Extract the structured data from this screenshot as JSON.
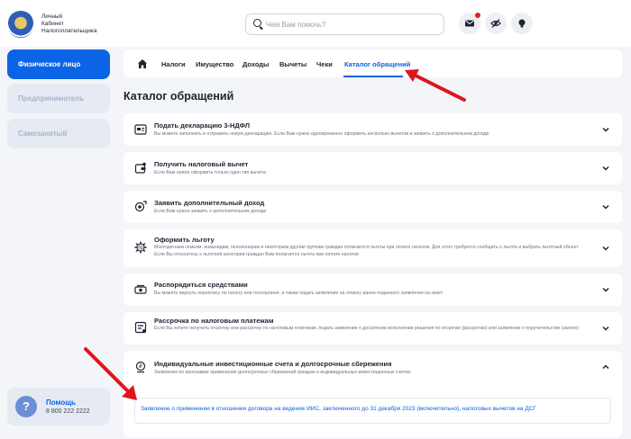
{
  "header": {
    "logo_lines": [
      "Личный",
      "Кабинет",
      "Налогоплательщика"
    ],
    "search_placeholder": "Чем Вам помочь?",
    "icons": [
      "mail-icon",
      "eye-off-icon",
      "lightbulb-icon"
    ]
  },
  "sidebar": {
    "items": [
      {
        "label": "Физическое лицо",
        "active": true
      },
      {
        "label": "Предприниматель",
        "active": false
      },
      {
        "label": "Самозанятый",
        "active": false
      }
    ],
    "help": {
      "title": "Помощь",
      "phone": "8 800 222 2222"
    }
  },
  "tabs": [
    {
      "label": "Налоги",
      "active": false
    },
    {
      "label": "Имущество",
      "active": false
    },
    {
      "label": "Доходы",
      "active": false
    },
    {
      "label": "Вычеты",
      "active": false
    },
    {
      "label": "Чеки",
      "active": false
    },
    {
      "label": "Каталог обращений",
      "active": true
    }
  ],
  "page_title": "Каталог обращений",
  "cards": [
    {
      "title": "Подать декларацию 3-НДФЛ",
      "desc": "Вы можете заполнить и отправить новую декларацию. Если Вам нужно одновременно оформить несколько вычетов и заявить о дополнительном доходе",
      "icon": "declaration-icon",
      "expanded": false
    },
    {
      "title": "Получить налоговый вычет",
      "desc": "Если Вам нужно оформить только один тип вычета",
      "icon": "wallet-icon",
      "expanded": false
    },
    {
      "title": "Заявить дополнительный доход",
      "desc": "Если Вам нужно заявить о дополнительном доходе",
      "icon": "income-icon",
      "expanded": false
    },
    {
      "title": "Оформить льготу",
      "desc": "Многодетным семьям, инвалидам, пенсионерам и некоторым другим группам граждан полагаются льготы при оплате налогов. Для этого требуется сообщить о льготе и выбрать льготный объект. Если Вы относитесь к льготной категории граждан Вам полагается льгота при оплате налогов",
      "icon": "benefit-icon",
      "expanded": false
    },
    {
      "title": "Распорядиться средствами",
      "desc": "Вы можете вернуть переплату по налогу или госпошлине, а также подать заявление на отмену ранее поданного заявления на зачет",
      "icon": "money-icon",
      "expanded": false
    },
    {
      "title": "Рассрочка по налоговым платежам",
      "desc": "Если Вы хотите получить отсрочку или рассрочку по налоговым платежам, подать заявление о досрочном исполнении решения по отсрочке (рассрочке) или заявление о поручительстве (залоге)",
      "icon": "installment-icon",
      "expanded": false
    },
    {
      "title": "Индивидуальные инвестиционные счета и долгосрочные сбережения",
      "desc": "Заявления по программе применения долгосрочных сбережений граждан и индивидуальных инвестиционных счетов.",
      "icon": "investment-icon",
      "expanded": true,
      "link": "Заявление о применении в отношении договора на ведение ИИС, заключенного до 31 декабря 2023 (включительно), налоговых вычетов на ДСГ"
    }
  ]
}
